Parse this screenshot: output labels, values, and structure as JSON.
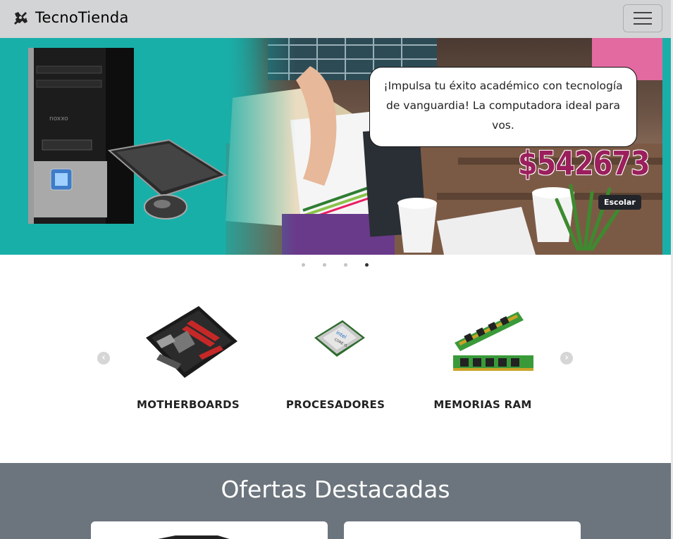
{
  "navbar": {
    "brand_name": "TecnoTienda",
    "brand_icon": "crossed-tools-icon",
    "menu_toggle_icon": "hamburger-icon"
  },
  "hero": {
    "message": "¡Impulsa tu éxito académico con tecnología de vanguardia! La computadora ideal para vos.",
    "price": "$542673",
    "badge": "Escolar",
    "slide_count": 4,
    "active_slide": 4
  },
  "categories": {
    "items": [
      {
        "label": "MOTHERBOARDS",
        "icon": "motherboard-icon"
      },
      {
        "label": "PROCESADORES",
        "icon": "processor-icon"
      },
      {
        "label": "MEMORIAS RAM",
        "icon": "ram-memory-icon"
      }
    ],
    "prev_icon": "chevron-left-icon",
    "next_icon": "chevron-right-icon"
  },
  "ofertas": {
    "title": "Ofertas Destacadas"
  },
  "colors": {
    "navbar_bg": "#d3d4d5",
    "hero_teal": "#19afa9",
    "price": "#9b1f5c",
    "ofertas_bg": "#6c757d"
  }
}
